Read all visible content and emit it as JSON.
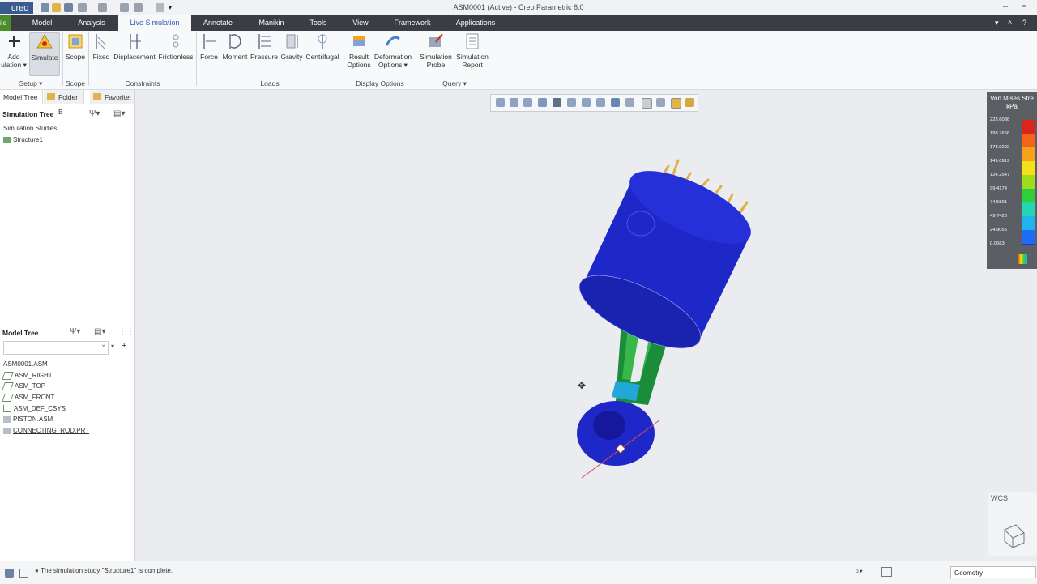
{
  "app": {
    "brand": "creo",
    "window_title": "ASM0001 (Active) - Creo Parametric 6.0"
  },
  "menu": {
    "file_tab": "ile",
    "tabs": [
      "Model",
      "Analysis",
      "Live Simulation",
      "Annotate",
      "Manikin",
      "Tools",
      "View",
      "Framework",
      "Applications"
    ],
    "active_tab": "Live Simulation"
  },
  "ribbon": {
    "buttons": {
      "add_simulation": [
        "Add",
        "ulation ▾"
      ],
      "simulate": "Simulate",
      "scope": "Scope",
      "fixed": "Fixed",
      "displacement": "Displacement",
      "frictionless": "Frictionless",
      "force": "Force",
      "moment": "Moment",
      "pressure": "Pressure",
      "gravity": "Gravity",
      "centrifugal": "Centrifugal",
      "result_options": [
        "Result",
        "Options"
      ],
      "deformation_options": [
        "Deformation",
        "Options ▾"
      ],
      "simulation_probe": [
        "Simulation",
        "Probe"
      ],
      "simulation_report": [
        "Simulation",
        "Report"
      ]
    },
    "groups": {
      "setup": "Setup ▾",
      "scope": "Scope",
      "constraints": "Constraints",
      "loads": "Loads",
      "display_options": "Display Options",
      "query": "Query ▾"
    }
  },
  "left_panel": {
    "tabs": [
      "Model Tree",
      "Folder B",
      "Favorite:"
    ],
    "simulation_tree": {
      "header": "Simulation Tree",
      "items": [
        "Simulation Studies",
        "Structure1"
      ]
    },
    "model_tree": {
      "header": "Model Tree",
      "items": [
        "ASM0001.ASM",
        "ASM_RIGHT",
        "ASM_TOP",
        "ASM_FRONT",
        "ASM_DEF_CSYS",
        "PISTON.ASM",
        "CONNECTING_ROD.PRT"
      ]
    }
  },
  "legend": {
    "title": [
      "Von Mises Stre",
      "kPa"
    ],
    "values": [
      "223.6038",
      "198.7666",
      "173.9292",
      "149.0919",
      "124.2547",
      "99.4174",
      "74.5801",
      "49.7428",
      "24.9056",
      "0.0683"
    ],
    "colors": [
      "#d9251c",
      "#f2641c",
      "#f6a21b",
      "#f4e11a",
      "#9fdc1c",
      "#2fce3a",
      "#22d6b0",
      "#1fb3f2",
      "#1e6df2",
      "#1b35e6"
    ]
  },
  "colors": {
    "accent": "#2a5db0",
    "menubar": "#3a3d44",
    "model_blue": "#1e28c8"
  },
  "viewport": {
    "wcs_label": "WCS"
  },
  "status": {
    "message": "The simulation study \"Structure1\" is complete.",
    "filter": "Geometry"
  }
}
